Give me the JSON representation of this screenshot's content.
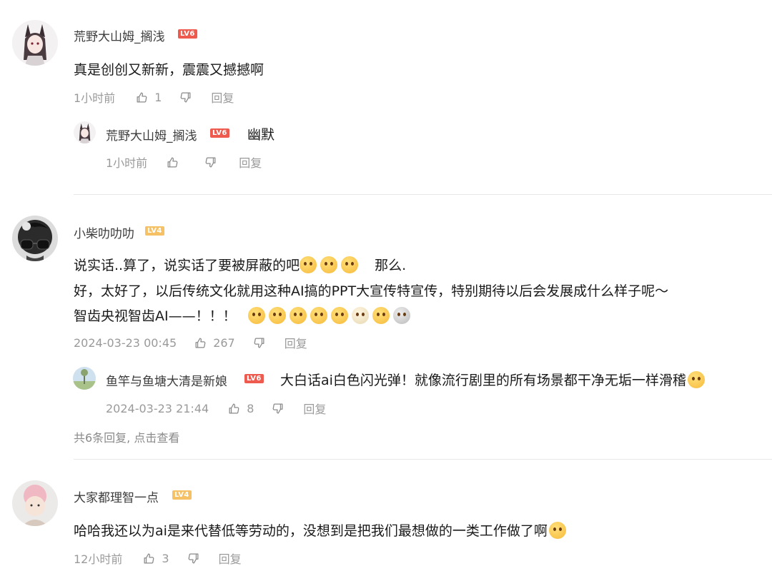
{
  "comments": [
    {
      "username": "荒野大山姆_搁浅",
      "level": "LV6",
      "text": "真是创创又新新，震震又撼撼啊",
      "time": "1小时前",
      "likes": "1",
      "reply_label": "回复",
      "replies": [
        {
          "username": "荒野大山姆_搁浅",
          "level": "LV6",
          "text": "幽默",
          "time": "1小时前",
          "likes": "",
          "reply_label": "回复"
        }
      ]
    },
    {
      "username": "小柴叻叻叻",
      "level": "LV4",
      "text_lines": [
        "说实话..算了，说实话了要被屏蔽的吧",
        "那么.",
        "好，太好了，以后传统文化就用这种AI搞的PPT大宣传特宣传，特别期待以后会发展成什么样子呢～",
        "智齿央视智齿AI——！！！"
      ],
      "time": "2024-03-23 00:45",
      "likes": "267",
      "reply_label": "回复",
      "replies": [
        {
          "username": "鱼竿与鱼塘大清是新娘",
          "level": "LV6",
          "text": "大白话ai白色闪光弹！就像流行剧里的所有场景都干净无垢一样滑稽",
          "time": "2024-03-23 21:44",
          "likes": "8",
          "reply_label": "回复"
        }
      ],
      "more_replies": "共6条回复, 点击查看"
    },
    {
      "username": "大家都理智一点",
      "level": "LV4",
      "text": "哈哈我还以为ai是来代替低等劳动的，没想到是把我们最想做的一类工作做了啊",
      "time": "12小时前",
      "likes": "3",
      "reply_label": "回复"
    }
  ],
  "icons": [
    "thumbs-up-icon",
    "thumbs-down-icon"
  ],
  "colors": {
    "lv6": "#ee5a4d",
    "lv4": "#f6c164",
    "meta": "#9a9a9a",
    "divider": "#e7e7e7"
  }
}
